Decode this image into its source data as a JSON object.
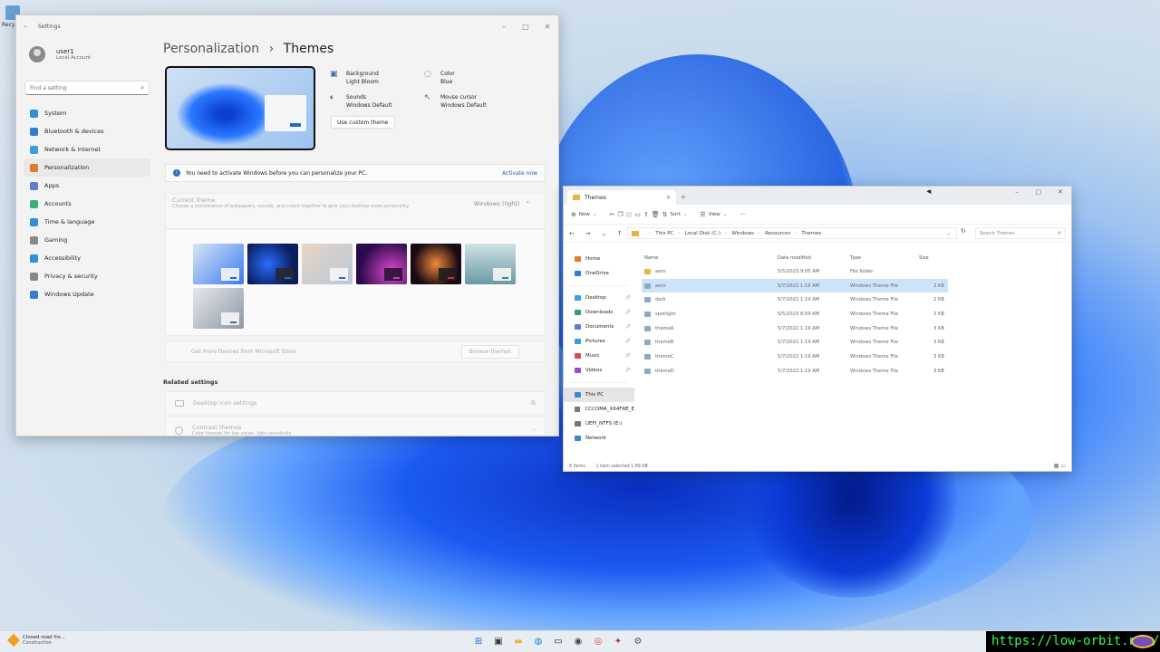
{
  "desktop": {
    "icon_label": "Recy"
  },
  "settings": {
    "window_title": "Settings",
    "user": {
      "name": "user1",
      "account": "Local Account"
    },
    "search_placeholder": "Find a setting",
    "nav": [
      {
        "label": "System",
        "icon": "system-icon",
        "color": "#2f8fd8"
      },
      {
        "label": "Bluetooth & devices",
        "icon": "bluetooth-icon",
        "color": "#2f7fd8"
      },
      {
        "label": "Network & internet",
        "icon": "wifi-icon",
        "color": "#3a9ee0"
      },
      {
        "label": "Personalization",
        "icon": "brush-icon",
        "color": "#e07a30"
      },
      {
        "label": "Apps",
        "icon": "apps-icon",
        "color": "#5a7fd0"
      },
      {
        "label": "Accounts",
        "icon": "accounts-icon",
        "color": "#3bb07a"
      },
      {
        "label": "Time & language",
        "icon": "globe-clock-icon",
        "color": "#2f8fd8"
      },
      {
        "label": "Gaming",
        "icon": "gamepad-icon",
        "color": "#888888"
      },
      {
        "label": "Accessibility",
        "icon": "accessibility-icon",
        "color": "#2f8fd8"
      },
      {
        "label": "Privacy & security",
        "icon": "shield-icon",
        "color": "#888888"
      },
      {
        "label": "Windows Update",
        "icon": "update-icon",
        "color": "#2f7fd8"
      }
    ],
    "active_nav": "Personalization",
    "breadcrumb": {
      "parent": "Personalization",
      "sep": "›",
      "current": "Themes"
    },
    "props": {
      "background": {
        "title": "Background",
        "value": "Light Bloom"
      },
      "color": {
        "title": "Color",
        "value": "Blue"
      },
      "sounds": {
        "title": "Sounds",
        "value": "Windows Default"
      },
      "cursor": {
        "title": "Mouse cursor",
        "value": "Windows Default"
      }
    },
    "custom_theme_button": "Use custom theme",
    "notice": {
      "text": "You need to activate Windows before you can personalize your PC.",
      "action": "Activate now"
    },
    "current_theme": {
      "title": "Current theme",
      "desc": "Choose a combination of wallpapers, sounds, and colors together to give your desktop more personality",
      "value": "Windows (light)"
    },
    "store": {
      "text": "Get more themes from Microsoft Store",
      "button": "Browse themes"
    },
    "related_title": "Related settings",
    "related": [
      {
        "title": "Desktop icon settings",
        "sub": ""
      },
      {
        "title": "Contrast themes",
        "sub": "Color themes for low vision, light sensitivity"
      }
    ]
  },
  "explorer": {
    "tab_title": "Themes",
    "toolbar": {
      "new": "New",
      "sort": "Sort",
      "view": "View"
    },
    "path": [
      "This PC",
      "Local Disk (C:)",
      "Windows",
      "Resources",
      "Themes"
    ],
    "search_placeholder": "Search Themes",
    "sidebar": [
      {
        "label": "Home",
        "pin": false
      },
      {
        "label": "OneDrive",
        "pin": false
      },
      {
        "label": "Desktop",
        "pin": true
      },
      {
        "label": "Downloads",
        "pin": true
      },
      {
        "label": "Documents",
        "pin": true
      },
      {
        "label": "Pictures",
        "pin": true
      },
      {
        "label": "Music",
        "pin": true
      },
      {
        "label": "Videos",
        "pin": true
      },
      {
        "label": "This PC",
        "pin": false
      },
      {
        "label": "CCCOMA_X64FRE_E",
        "pin": false
      },
      {
        "label": "UEFI_NTFS (E:)",
        "pin": false
      },
      {
        "label": "Network",
        "pin": false
      }
    ],
    "columns": {
      "name": "Name",
      "date": "Date modified",
      "type": "Type",
      "size": "Size"
    },
    "rows": [
      {
        "name": "aero",
        "date": "5/5/2023 9:05 AM",
        "type": "File folder",
        "size": "",
        "folder": true
      },
      {
        "name": "aero",
        "date": "5/7/2022 1:19 AM",
        "type": "Windows Theme File",
        "size": "2 KB",
        "folder": false
      },
      {
        "name": "dark",
        "date": "5/7/2022 1:19 AM",
        "type": "Windows Theme File",
        "size": "2 KB",
        "folder": false
      },
      {
        "name": "spotlight",
        "date": "5/5/2023 8:59 AM",
        "type": "Windows Theme File",
        "size": "2 KB",
        "folder": false
      },
      {
        "name": "themeA",
        "date": "5/7/2022 1:19 AM",
        "type": "Windows Theme File",
        "size": "3 KB",
        "folder": false
      },
      {
        "name": "themeB",
        "date": "5/7/2022 1:19 AM",
        "type": "Windows Theme File",
        "size": "3 KB",
        "folder": false
      },
      {
        "name": "themeC",
        "date": "5/7/2022 1:19 AM",
        "type": "Windows Theme File",
        "size": "3 KB",
        "folder": false
      },
      {
        "name": "themeD",
        "date": "5/7/2022 1:19 AM",
        "type": "Windows Theme File",
        "size": "3 KB",
        "folder": false
      }
    ],
    "status": {
      "items": "8 items",
      "selected": "1 item selected 1.89 KB"
    }
  },
  "taskbar": {
    "weather": {
      "title": "Closed road fro...",
      "sub": "Construction"
    },
    "apps": [
      "start-icon",
      "taskview-icon",
      "file-explorer-icon",
      "edge-icon",
      "terminal-icon",
      "camera-icon",
      "chrome-icon",
      "media-icon",
      "settings-icon"
    ]
  },
  "watermark": "https://low-orbit.net/"
}
